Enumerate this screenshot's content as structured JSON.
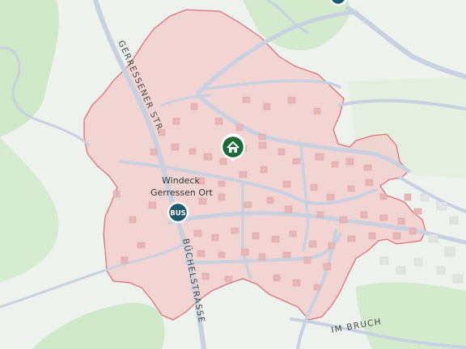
{
  "map": {
    "colors": {
      "background": "#eef2ec",
      "forest": "#cfe8c8",
      "area_fill": "#f4cccc",
      "area_border": "#e0707a",
      "road": "#c9d3e0",
      "building": "#e9b8b8",
      "marker_home": "#1b6b3a",
      "marker_bus": "#1b5a6b"
    },
    "place_label_line1": "Windeck",
    "place_label_line2": "Gerressen Ort",
    "street_gerressener": "GERRESSENER STR.",
    "street_buechel": "BÜCHELSTRASSE",
    "street_im_bruch": "IM BRUCH",
    "bus_label": "BUS",
    "home_marker_icon": "house-icon",
    "bus_marker_icon": "bus-stop-icon"
  }
}
